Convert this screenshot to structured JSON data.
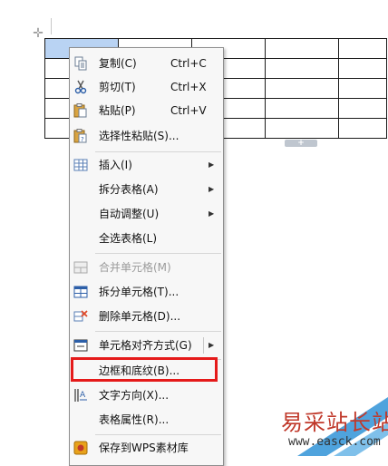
{
  "menu": {
    "items": [
      {
        "label": "复制(C)",
        "shortcut": "Ctrl+C",
        "icon": "copy-icon"
      },
      {
        "label": "剪切(T)",
        "shortcut": "Ctrl+X",
        "icon": "scissors-icon"
      },
      {
        "label": "粘贴(P)",
        "shortcut": "Ctrl+V",
        "icon": "paste-icon"
      },
      {
        "label": "选择性粘贴(S)...",
        "icon": "paste-special-icon"
      },
      {
        "label": "插入(I)",
        "icon": "table-insert-icon",
        "submenu": true
      },
      {
        "label": "拆分表格(A)",
        "submenu": true
      },
      {
        "label": "自动调整(U)",
        "submenu": true
      },
      {
        "label": "全选表格(L)"
      },
      {
        "label": "合并单元格(M)",
        "icon": "merge-cells-icon",
        "disabled": true
      },
      {
        "label": "拆分单元格(T)...",
        "icon": "split-cells-icon"
      },
      {
        "label": "删除单元格(D)...",
        "icon": "delete-cells-icon"
      },
      {
        "label": "单元格对齐方式(G)",
        "icon": "cell-align-icon",
        "submenu": true
      },
      {
        "label": "边框和底纹(B)...",
        "highlighted": true
      },
      {
        "label": "文字方向(X)...",
        "icon": "text-direction-icon"
      },
      {
        "label": "表格属性(R)..."
      },
      {
        "label": "保存到WPS素材库",
        "icon": "wps-library-icon"
      }
    ]
  },
  "watermark": {
    "text": "易采站长站",
    "url": "www.easck.com"
  },
  "colors": {
    "highlight_border": "#e51a1a",
    "selected_cell": "#b9d3f3",
    "watermark_text": "#c0392b"
  }
}
